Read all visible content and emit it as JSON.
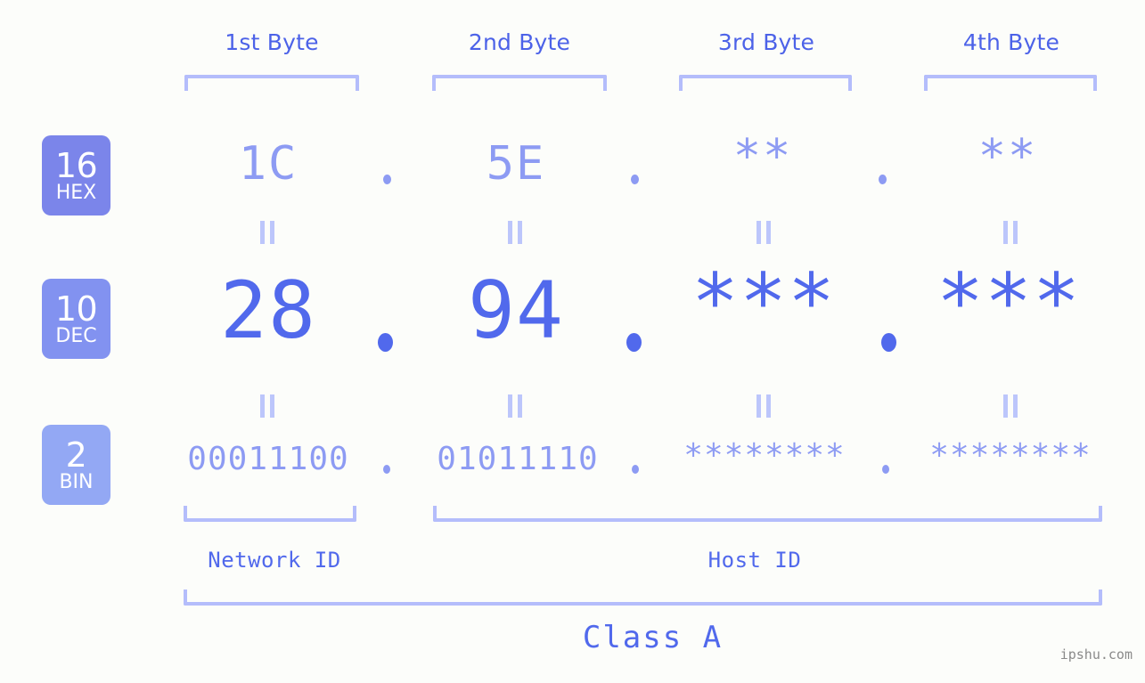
{
  "watermark": "ipshu.com",
  "colors": {
    "background": "#fcfdfa",
    "accent_strong": "#5169ec",
    "accent_mid": "#8d9bf3",
    "accent_light": "#b4bdfb",
    "badge_hex": "#7b85ea",
    "badge_dec": "#8292f0",
    "badge_bin": "#93a8f4"
  },
  "byte_headers": [
    {
      "label": "1st Byte"
    },
    {
      "label": "2nd Byte"
    },
    {
      "label": "3rd Byte"
    },
    {
      "label": "4th Byte"
    }
  ],
  "rows": [
    {
      "badge_number": "16",
      "badge_name": "HEX",
      "values": [
        "1C",
        "5E",
        "**",
        "**"
      ],
      "separator": "."
    },
    {
      "badge_number": "10",
      "badge_name": "DEC",
      "values": [
        "28",
        "94",
        "***",
        "***"
      ],
      "separator": "."
    },
    {
      "badge_number": "2",
      "badge_name": "BIN",
      "values": [
        "00011100",
        "01011110",
        "********",
        "********"
      ],
      "separator": "."
    }
  ],
  "sections": {
    "network_id": "Network ID",
    "host_id": "Host ID",
    "class": "Class A"
  }
}
